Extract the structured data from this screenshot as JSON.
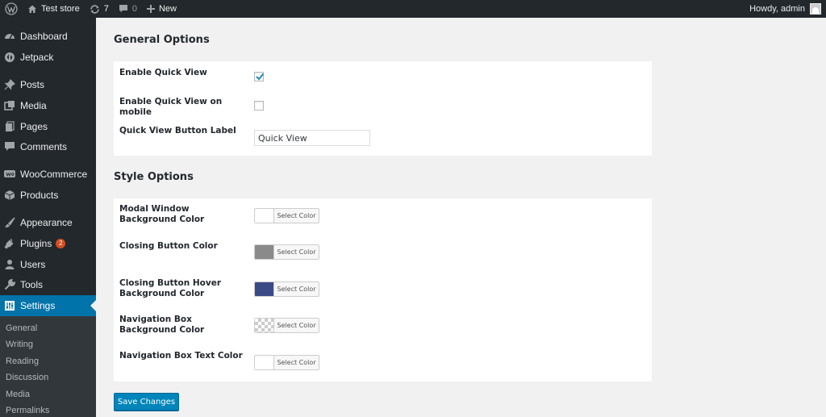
{
  "admin_bar": {
    "site_name": "Test store",
    "updates_count": "7",
    "comments_count": "0",
    "new_label": "New",
    "greeting": "Howdy, admin"
  },
  "sidebar": {
    "items": [
      {
        "label": "Dashboard",
        "icon": "dashboard-icon"
      },
      {
        "label": "Jetpack",
        "icon": "jetpack-icon"
      },
      {
        "label": "Posts",
        "icon": "pin-icon"
      },
      {
        "label": "Media",
        "icon": "media-icon"
      },
      {
        "label": "Pages",
        "icon": "pages-icon"
      },
      {
        "label": "Comments",
        "icon": "comment-icon"
      },
      {
        "label": "WooCommerce",
        "icon": "woocommerce-icon"
      },
      {
        "label": "Products",
        "icon": "products-icon"
      },
      {
        "label": "Appearance",
        "icon": "brush-icon"
      },
      {
        "label": "Plugins",
        "icon": "plugin-icon",
        "badge": "2"
      },
      {
        "label": "Users",
        "icon": "user-icon"
      },
      {
        "label": "Tools",
        "icon": "wrench-icon"
      },
      {
        "label": "Settings",
        "icon": "settings-icon",
        "active": true
      }
    ],
    "submenu": [
      "General",
      "Writing",
      "Reading",
      "Discussion",
      "Media",
      "Permalinks"
    ]
  },
  "main": {
    "general_title": "General Options",
    "general": {
      "enable_quick_view_label": "Enable Quick View",
      "enable_quick_view_checked": true,
      "enable_mobile_label": "Enable Quick View on mobile",
      "enable_mobile_checked": false,
      "button_label_label": "Quick View Button Label",
      "button_label_value": "Quick View"
    },
    "style_title": "Style Options",
    "style": [
      {
        "label": "Modal Window Background Color",
        "color": "#ffffff",
        "button": "Select Color"
      },
      {
        "label": "Closing Button Color",
        "color": "#8a8a8a",
        "button": "Select Color"
      },
      {
        "label": "Closing Button Hover Background Color",
        "color": "#3b4a86",
        "button": "Select Color"
      },
      {
        "label": "Navigation Box Background Color",
        "color": "transparent",
        "button": "Select Color"
      },
      {
        "label": "Navigation Box Text Color",
        "color": "#ffffff",
        "button": "Select Color"
      }
    ],
    "save_label": "Save Changes"
  }
}
